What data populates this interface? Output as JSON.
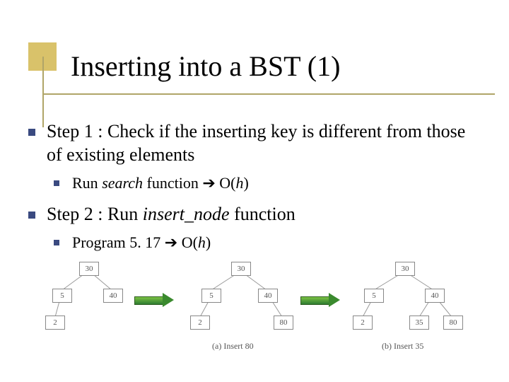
{
  "title": "Inserting into a BST (1)",
  "body": {
    "step1": "Step 1 : Check if the inserting key is different from those of existing elements",
    "step1_sub_prefix": "Run ",
    "step1_sub_search": "search",
    "step1_sub_mid": " function ",
    "step1_sub_arrow": "➔",
    "step1_sub_bigO_open": " O(",
    "step1_sub_h": "h",
    "step1_sub_bigO_close": ")",
    "step2_prefix": "Step 2 : Run ",
    "step2_fn": "insert_node",
    "step2_suffix": " function",
    "step2_sub_prefix": "Program 5. 17 ",
    "step2_sub_arrow": "➔",
    "step2_sub_bigO_open": " O(",
    "step2_sub_h": "h",
    "step2_sub_bigO_close": ")"
  },
  "trees": {
    "t1": {
      "root": "30",
      "left": "5",
      "right": "40",
      "leftleft": "2"
    },
    "t2": {
      "root": "30",
      "left": "5",
      "right": "40",
      "leftleft": "2",
      "rightright": "80"
    },
    "t3": {
      "root": "30",
      "left": "5",
      "right": "40",
      "leftleft": "2",
      "rightleft": "35",
      "rightright": "80"
    }
  },
  "captions": {
    "a": "(a) Insert 80",
    "b": "(b) Insert 35"
  }
}
